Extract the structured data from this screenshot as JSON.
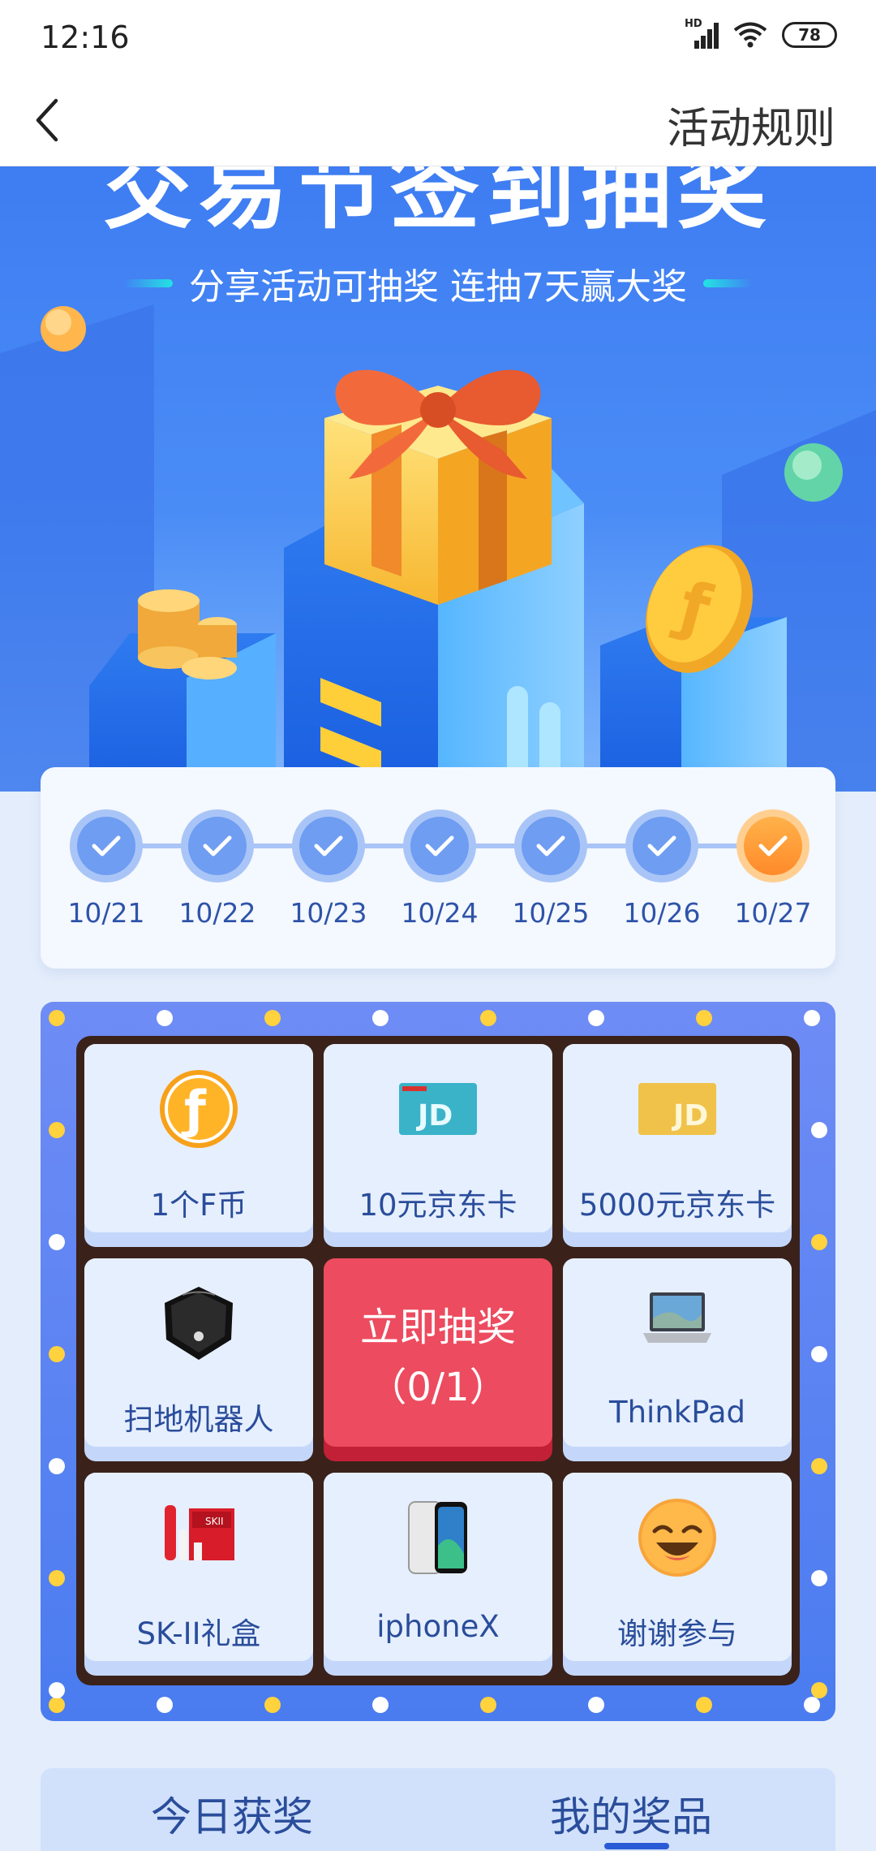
{
  "status_bar": {
    "time": "12:16",
    "hd_label": "HD",
    "battery_level": "78"
  },
  "nav": {
    "back_icon": "chevron-left-icon",
    "rules_label": "活动规则"
  },
  "banner": {
    "title": "交易节签到抽奖",
    "subtitle": "分享活动可抽奖 连抽7天赢大奖"
  },
  "checkin": {
    "dates": [
      {
        "label": "10/21",
        "checked": true,
        "today": false
      },
      {
        "label": "10/22",
        "checked": true,
        "today": false
      },
      {
        "label": "10/23",
        "checked": true,
        "today": false
      },
      {
        "label": "10/24",
        "checked": true,
        "today": false
      },
      {
        "label": "10/25",
        "checked": true,
        "today": false
      },
      {
        "label": "10/26",
        "checked": true,
        "today": false
      },
      {
        "label": "10/27",
        "checked": true,
        "today": true
      }
    ]
  },
  "lottery": {
    "prizes": [
      {
        "label": "1个F币",
        "icon": "f-coin-icon"
      },
      {
        "label": "10元京东卡",
        "icon": "jd-card-blue-icon"
      },
      {
        "label": "5000元京东卡",
        "icon": "jd-card-gold-icon"
      },
      {
        "label": "ThinkPad",
        "icon": "laptop-icon"
      },
      {
        "label": "iphoneX",
        "icon": "phone-icon"
      },
      {
        "label": "SK-II礼盒",
        "icon": "gift-box-icon"
      },
      {
        "label": "扫地机器人",
        "icon": "robot-vacuum-icon"
      },
      {
        "label": "谢谢参与",
        "icon": "smiley-icon"
      }
    ],
    "draw_button": {
      "label": "立即抽奖",
      "count": "（0/1）"
    }
  },
  "tabs": [
    {
      "label": "今日获奖",
      "active": false
    },
    {
      "label": "我的奖品",
      "active": true
    }
  ],
  "colors": {
    "primary_blue": "#4a7cf0",
    "draw_red": "#ed4b5f",
    "today_orange": "#ff8a2a",
    "text_blue": "#2a4d9b"
  }
}
